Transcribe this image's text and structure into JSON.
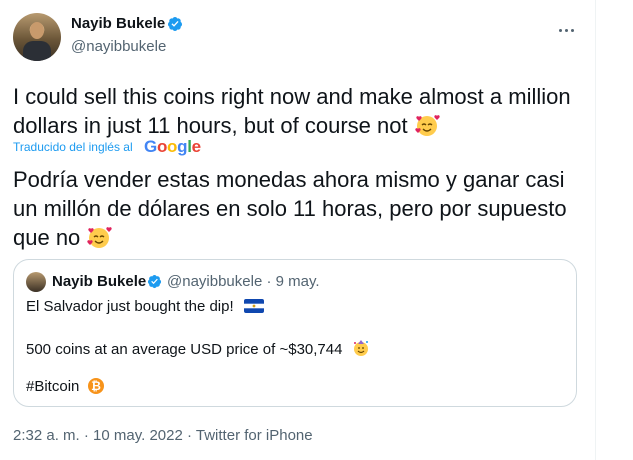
{
  "author": {
    "display_name": "Nayib Bukele",
    "handle": "@nayibbukele",
    "verified": true
  },
  "tweet": {
    "text": "I could sell this coins right now and make almost a million dollars in just 11 hours, but of course not",
    "translated_label": "Traducido del inglés al",
    "translator_brand": "Google",
    "translation": "Podría vender estas monedas ahora mismo y ganar casi un millón de dólares en solo 11 horas, pero por supuesto que no"
  },
  "quoted_tweet": {
    "display_name": "Nayib Bukele",
    "handle_date": "@nayibbukele · 9 may.",
    "line1": "El Salvador just bought the dip!",
    "line2": "500 coins at an average USD price of ~$30,744",
    "hashtag": "#Bitcoin"
  },
  "meta": {
    "time": "2:32 a. m.",
    "date": "10 may. 2022",
    "source": "Twitter for iPhone",
    "separator": " · "
  },
  "colors": {
    "link_blue": "#1d9bf0",
    "secondary_text": "#536471",
    "border": "#cfd9de"
  },
  "icons": [
    "verified-badge-icon",
    "more-icon",
    "smiling-hearts-emoji",
    "el-salvador-flag-emoji",
    "bitcoin-icon",
    "party-face-emoji"
  ]
}
